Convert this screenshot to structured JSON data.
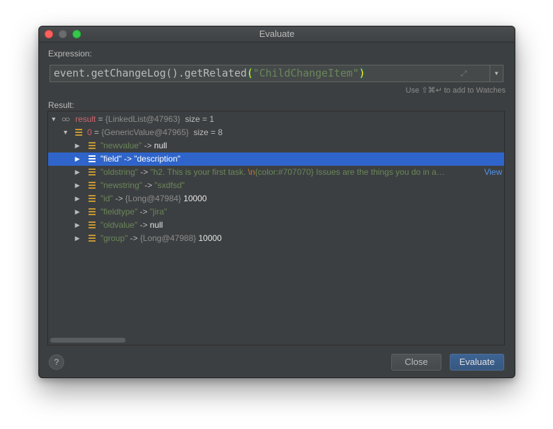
{
  "window": {
    "title": "Evaluate",
    "expression_label": "Expression:",
    "result_label": "Result:",
    "watch_hint": "Use ⇧⌘↵ to add to Watches",
    "help_label": "?",
    "close_label": "Close",
    "evaluate_label": "Evaluate"
  },
  "expression": {
    "prefix": "event.getChangeLog().getRelated",
    "open_paren": "(",
    "string_arg": "\"ChildChangeItem\"",
    "close_paren": ")"
  },
  "tree": {
    "root": {
      "name": "result",
      "eq": " = ",
      "type": "{LinkedList@47963}",
      "size": "size = 1"
    },
    "child": {
      "name": "0",
      "eq": " = ",
      "type": "{GenericValue@47965}",
      "size": "size = 8"
    },
    "entries": [
      {
        "key": "\"newvalue\"",
        "arrow": " -> ",
        "value": "null"
      },
      {
        "key": "\"field\"",
        "arrow": " -> ",
        "value": "\"description\""
      },
      {
        "key": "\"oldstring\"",
        "arrow": " -> ",
        "value_prefix": "\"h2. This is your first task. ",
        "value_escape": "\\n",
        "value_rest": "{color:#707070} Issues are the things you do in a…",
        "link": "View"
      },
      {
        "key": "\"newstring\"",
        "arrow": " -> ",
        "value": "\"sxdfsd\""
      },
      {
        "key": "\"id\"",
        "arrow": " -> ",
        "type": "{Long@47984}",
        "value": "10000"
      },
      {
        "key": "\"fieldtype\"",
        "arrow": " -> ",
        "value": "\"jira\""
      },
      {
        "key": "\"oldvalue\"",
        "arrow": " -> ",
        "value": "null"
      },
      {
        "key": "\"group\"",
        "arrow": " -> ",
        "type": "{Long@47988}",
        "value": "10000"
      }
    ],
    "selected_index": 1
  },
  "colors": {
    "background": "#3c3f41",
    "selection": "#2f65ca",
    "string_green": "#6a8759",
    "name_red": "#cc666e",
    "field_icon": "#c69734",
    "link_blue": "#5394ec"
  }
}
